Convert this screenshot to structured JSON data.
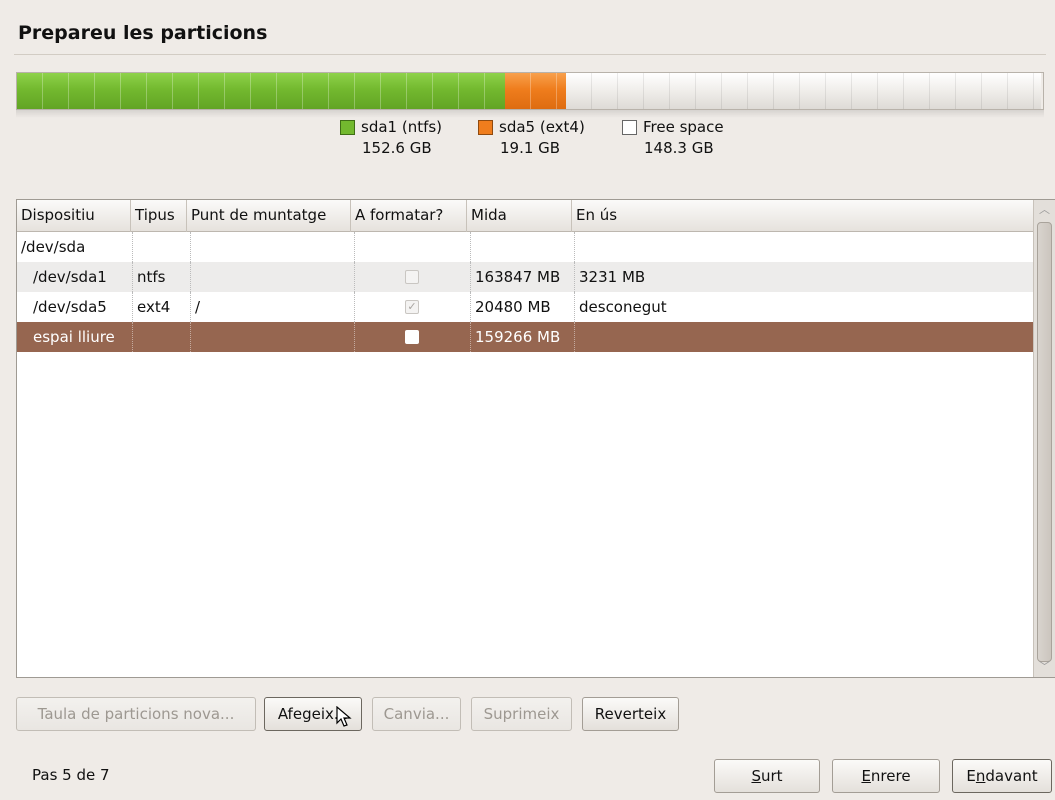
{
  "title": "Prepareu les particions",
  "partition_bar": {
    "segments": [
      {
        "name": "sda1",
        "fraction": 0.4759,
        "color": "#73b92f"
      },
      {
        "name": "sda5",
        "fraction": 0.0596,
        "color": "#ef7d1d"
      },
      {
        "name": "free",
        "fraction": 0.4625,
        "color": "#ffffff"
      }
    ]
  },
  "legend": [
    {
      "label": "sda1 (ntfs)",
      "size": "152.6 GB",
      "swatch": "green"
    },
    {
      "label": "sda5 (ext4)",
      "size": "19.1 GB",
      "swatch": "orange"
    },
    {
      "label": "Free space",
      "size": "148.3 GB",
      "swatch": "white"
    }
  ],
  "table": {
    "columns": [
      "Dispositiu",
      "Tipus",
      "Punt de muntatge",
      "A formatar?",
      "Mida",
      "En ús"
    ],
    "rows": [
      {
        "device": "/dev/sda",
        "type": "",
        "mount": "",
        "format": null,
        "size": "",
        "used": ""
      },
      {
        "device": "/dev/sda1",
        "type": "ntfs",
        "mount": "",
        "format": false,
        "size": "163847 MB",
        "used": "3231 MB"
      },
      {
        "device": "/dev/sda5",
        "type": "ext4",
        "mount": "/",
        "format": true,
        "size": "20480 MB",
        "used": "desconegut"
      },
      {
        "device": "espai lliure",
        "type": "",
        "mount": "",
        "format": false,
        "size": "159266 MB",
        "used": ""
      }
    ],
    "selected_row": 3
  },
  "actions": {
    "new_table": "Taula de particions nova...",
    "add": "Afegeix...",
    "change": "Canvia...",
    "delete": "Suprimeix",
    "revert": "Reverteix"
  },
  "footer": {
    "step": "Pas 5 de 7",
    "quit_pre": "",
    "quit_key": "S",
    "quit_post": "urt",
    "back_pre": "",
    "back_key": "E",
    "back_post": "nrere",
    "forward_pre": "E",
    "forward_key": "n",
    "forward_post": "davant"
  }
}
